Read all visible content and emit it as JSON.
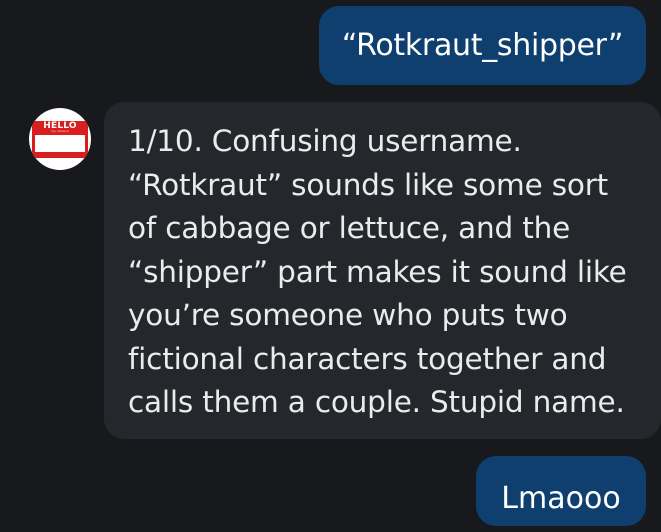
{
  "messages": {
    "outgoing_1": "“Rotkraut_shipper”",
    "incoming_lines": [
      "1/10. Confusing username.",
      "“Rotkraut” sounds like some sort",
      "of cabbage or lettuce, and the",
      "“shipper” part makes it sound like",
      "you’re someone who puts two",
      "fictional characters together and",
      "calls them a couple. Stupid name."
    ],
    "outgoing_2": "Lmaooo"
  },
  "avatar": {
    "tag_text": "HELLO",
    "tag_subtext": "my name is"
  },
  "colors": {
    "background": "#17191c",
    "outgoing_bubble": "#0e3f6e",
    "incoming_bubble": "#24272b",
    "text": "#ebebeb"
  }
}
